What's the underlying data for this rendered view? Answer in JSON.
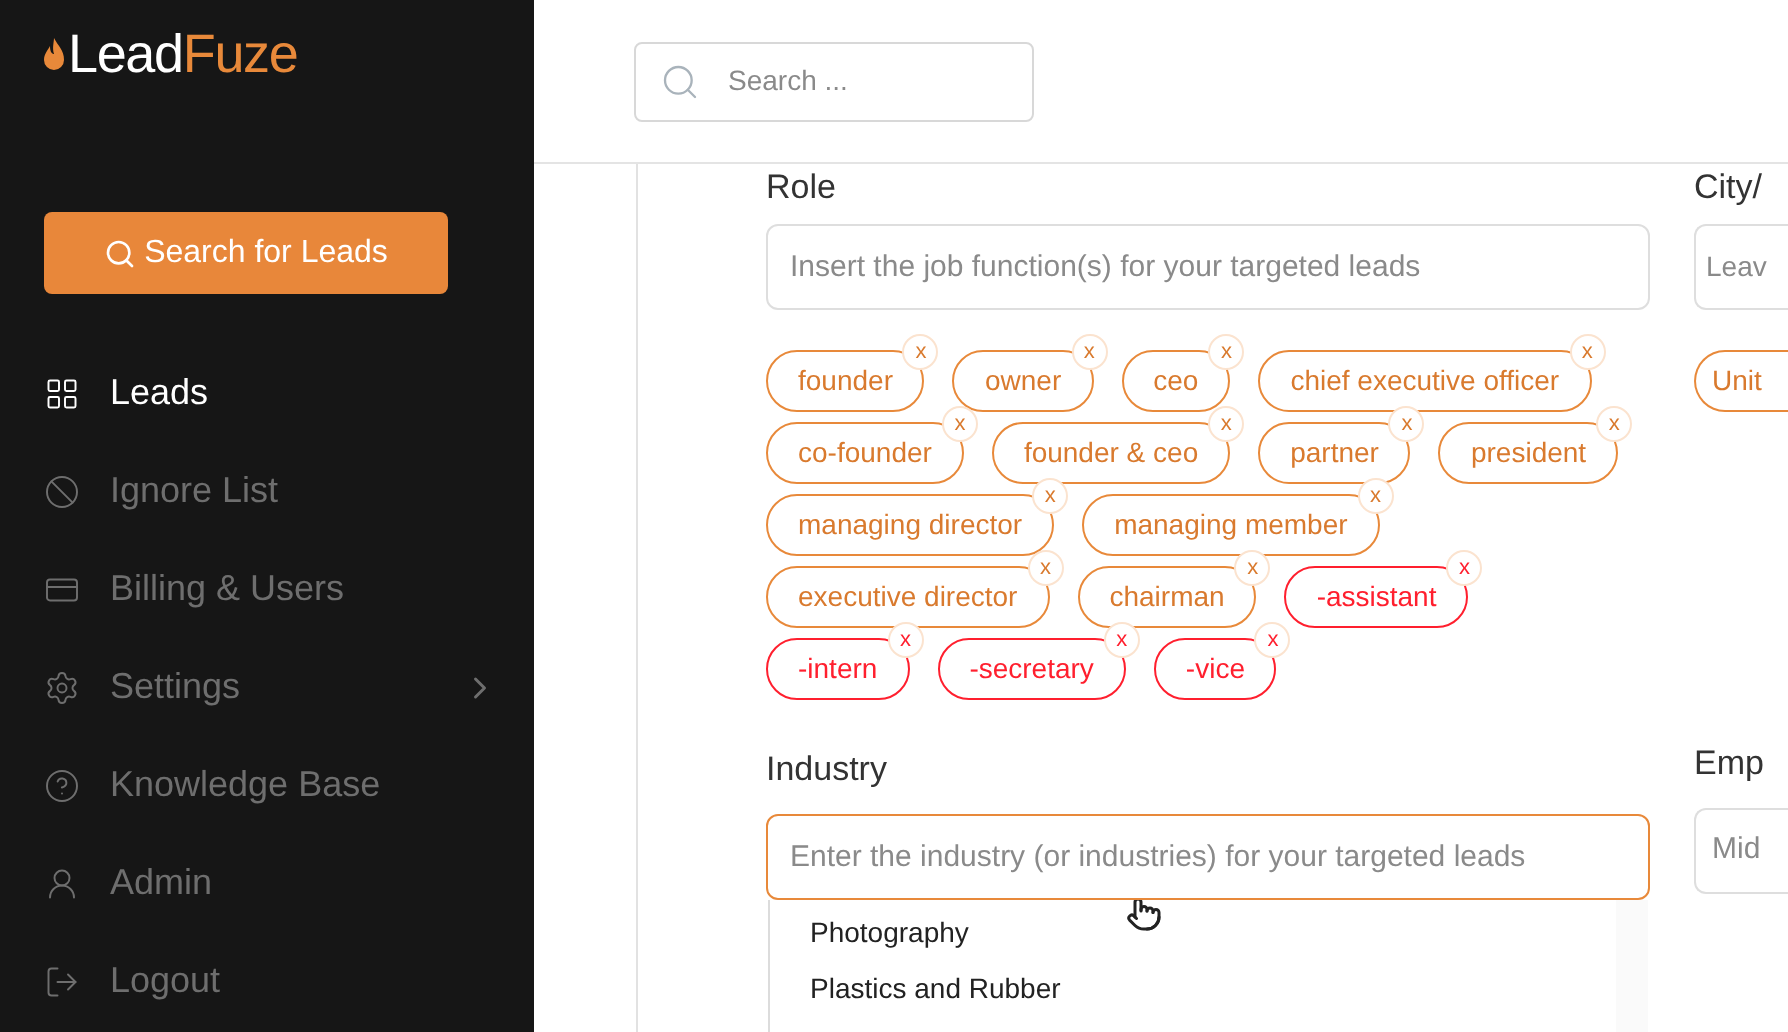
{
  "logo": {
    "part_1": "Lead",
    "part_2": "Fuze"
  },
  "sidebar": {
    "button": "Search for Leads",
    "items": [
      {
        "label": "Leads",
        "selected": true,
        "chevron": false
      },
      {
        "label": "Ignore List",
        "selected": false,
        "chevron": false
      },
      {
        "label": "Billing & Users",
        "selected": false,
        "chevron": false
      },
      {
        "label": "Settings",
        "selected": false,
        "chevron": true
      },
      {
        "label": "Knowledge Base",
        "selected": false,
        "chevron": false
      },
      {
        "label": "Admin",
        "selected": false,
        "chevron": false
      },
      {
        "label": "Logout",
        "selected": false,
        "chevron": false
      }
    ]
  },
  "header": {
    "search": {
      "placeholder": "Search ..."
    }
  },
  "role": {
    "label": "Role",
    "placeholder": "Insert the job function(s) for your targeted leads",
    "tags": [
      {
        "text": "founder",
        "kind": "include",
        "remove": "x"
      },
      {
        "text": "owner",
        "kind": "include",
        "remove": "x"
      },
      {
        "text": "ceo",
        "kind": "include",
        "remove": "x"
      },
      {
        "text": "chief executive officer",
        "kind": "include",
        "remove": "x"
      },
      {
        "text": "co-founder",
        "kind": "include",
        "remove": "x"
      },
      {
        "text": "founder & ceo",
        "kind": "include",
        "remove": "x"
      },
      {
        "text": "partner",
        "kind": "include",
        "remove": "x"
      },
      {
        "text": "president",
        "kind": "include",
        "remove": "x"
      },
      {
        "text": "managing director",
        "kind": "include",
        "remove": "x"
      },
      {
        "text": "managing member",
        "kind": "include",
        "remove": "x"
      },
      {
        "text": "executive director",
        "kind": "include",
        "remove": "x"
      },
      {
        "text": "chairman",
        "kind": "include",
        "remove": "x"
      },
      {
        "text": "-assistant",
        "kind": "exclude",
        "remove": "x"
      },
      {
        "text": "-intern",
        "kind": "exclude",
        "remove": "x"
      },
      {
        "text": "-secretary",
        "kind": "exclude",
        "remove": "x"
      },
      {
        "text": "-vice",
        "kind": "exclude",
        "remove": "x"
      }
    ]
  },
  "industry": {
    "label": "Industry",
    "placeholder": "Enter the industry (or industries) for your targeted leads",
    "options": [
      "Photography",
      "Plastics and Rubber"
    ]
  },
  "right_column": {
    "label_1": "City/",
    "placeholder_1": "Leav",
    "tag": "Unit",
    "label_2": "Emp",
    "placeholder_2": "Mid"
  }
}
